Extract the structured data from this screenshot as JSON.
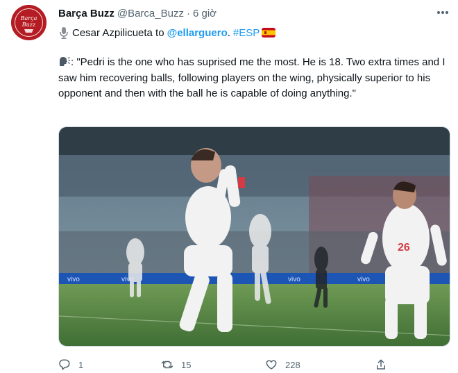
{
  "tweet": {
    "author_name": "Barça Buzz",
    "author_handle": "@Barca_Buzz",
    "separator": "·",
    "timestamp": "6 giờ",
    "line1_prefix": "Cesar Azpilicueta to",
    "mention": "@ellarguero",
    "line1_period": ".",
    "hashtag": "#ESP",
    "quote_sep": ":",
    "quote": "\"Pedri is the one who has suprised me the most. He is 18. Two extra times and I saw him recovering balls, following players on the wing, physically superior to his opponent and then with the ball he is capable of doing anything.\"",
    "avatar_text": "BarçaBuzz"
  },
  "metrics": {
    "replies": "1",
    "retweets": "15",
    "likes": "228"
  },
  "colors": {
    "accent": "#1d9bf0",
    "brand": "#b51b22",
    "muted": "#536471"
  },
  "icons": [
    "more-icon",
    "microphone-icon",
    "spain-flag-icon",
    "speaking-head-icon",
    "reply-icon",
    "retweet-icon",
    "like-icon",
    "share-icon"
  ]
}
